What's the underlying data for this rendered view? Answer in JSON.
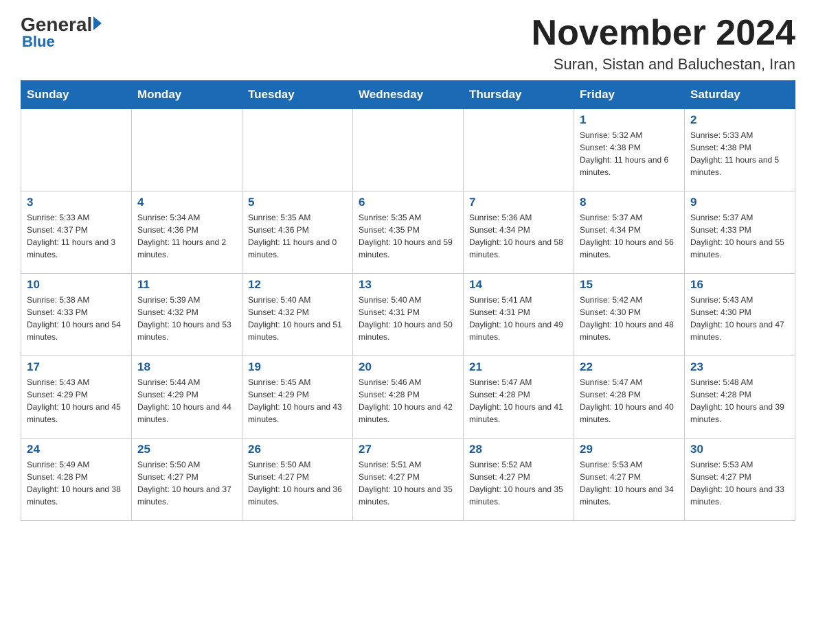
{
  "logo": {
    "general": "General",
    "blue": "Blue"
  },
  "title": "November 2024",
  "subtitle": "Suran, Sistan and Baluchestan, Iran",
  "weekdays": [
    "Sunday",
    "Monday",
    "Tuesday",
    "Wednesday",
    "Thursday",
    "Friday",
    "Saturday"
  ],
  "weeks": [
    [
      {
        "day": "",
        "info": ""
      },
      {
        "day": "",
        "info": ""
      },
      {
        "day": "",
        "info": ""
      },
      {
        "day": "",
        "info": ""
      },
      {
        "day": "",
        "info": ""
      },
      {
        "day": "1",
        "info": "Sunrise: 5:32 AM\nSunset: 4:38 PM\nDaylight: 11 hours and 6 minutes."
      },
      {
        "day": "2",
        "info": "Sunrise: 5:33 AM\nSunset: 4:38 PM\nDaylight: 11 hours and 5 minutes."
      }
    ],
    [
      {
        "day": "3",
        "info": "Sunrise: 5:33 AM\nSunset: 4:37 PM\nDaylight: 11 hours and 3 minutes."
      },
      {
        "day": "4",
        "info": "Sunrise: 5:34 AM\nSunset: 4:36 PM\nDaylight: 11 hours and 2 minutes."
      },
      {
        "day": "5",
        "info": "Sunrise: 5:35 AM\nSunset: 4:36 PM\nDaylight: 11 hours and 0 minutes."
      },
      {
        "day": "6",
        "info": "Sunrise: 5:35 AM\nSunset: 4:35 PM\nDaylight: 10 hours and 59 minutes."
      },
      {
        "day": "7",
        "info": "Sunrise: 5:36 AM\nSunset: 4:34 PM\nDaylight: 10 hours and 58 minutes."
      },
      {
        "day": "8",
        "info": "Sunrise: 5:37 AM\nSunset: 4:34 PM\nDaylight: 10 hours and 56 minutes."
      },
      {
        "day": "9",
        "info": "Sunrise: 5:37 AM\nSunset: 4:33 PM\nDaylight: 10 hours and 55 minutes."
      }
    ],
    [
      {
        "day": "10",
        "info": "Sunrise: 5:38 AM\nSunset: 4:33 PM\nDaylight: 10 hours and 54 minutes."
      },
      {
        "day": "11",
        "info": "Sunrise: 5:39 AM\nSunset: 4:32 PM\nDaylight: 10 hours and 53 minutes."
      },
      {
        "day": "12",
        "info": "Sunrise: 5:40 AM\nSunset: 4:32 PM\nDaylight: 10 hours and 51 minutes."
      },
      {
        "day": "13",
        "info": "Sunrise: 5:40 AM\nSunset: 4:31 PM\nDaylight: 10 hours and 50 minutes."
      },
      {
        "day": "14",
        "info": "Sunrise: 5:41 AM\nSunset: 4:31 PM\nDaylight: 10 hours and 49 minutes."
      },
      {
        "day": "15",
        "info": "Sunrise: 5:42 AM\nSunset: 4:30 PM\nDaylight: 10 hours and 48 minutes."
      },
      {
        "day": "16",
        "info": "Sunrise: 5:43 AM\nSunset: 4:30 PM\nDaylight: 10 hours and 47 minutes."
      }
    ],
    [
      {
        "day": "17",
        "info": "Sunrise: 5:43 AM\nSunset: 4:29 PM\nDaylight: 10 hours and 45 minutes."
      },
      {
        "day": "18",
        "info": "Sunrise: 5:44 AM\nSunset: 4:29 PM\nDaylight: 10 hours and 44 minutes."
      },
      {
        "day": "19",
        "info": "Sunrise: 5:45 AM\nSunset: 4:29 PM\nDaylight: 10 hours and 43 minutes."
      },
      {
        "day": "20",
        "info": "Sunrise: 5:46 AM\nSunset: 4:28 PM\nDaylight: 10 hours and 42 minutes."
      },
      {
        "day": "21",
        "info": "Sunrise: 5:47 AM\nSunset: 4:28 PM\nDaylight: 10 hours and 41 minutes."
      },
      {
        "day": "22",
        "info": "Sunrise: 5:47 AM\nSunset: 4:28 PM\nDaylight: 10 hours and 40 minutes."
      },
      {
        "day": "23",
        "info": "Sunrise: 5:48 AM\nSunset: 4:28 PM\nDaylight: 10 hours and 39 minutes."
      }
    ],
    [
      {
        "day": "24",
        "info": "Sunrise: 5:49 AM\nSunset: 4:28 PM\nDaylight: 10 hours and 38 minutes."
      },
      {
        "day": "25",
        "info": "Sunrise: 5:50 AM\nSunset: 4:27 PM\nDaylight: 10 hours and 37 minutes."
      },
      {
        "day": "26",
        "info": "Sunrise: 5:50 AM\nSunset: 4:27 PM\nDaylight: 10 hours and 36 minutes."
      },
      {
        "day": "27",
        "info": "Sunrise: 5:51 AM\nSunset: 4:27 PM\nDaylight: 10 hours and 35 minutes."
      },
      {
        "day": "28",
        "info": "Sunrise: 5:52 AM\nSunset: 4:27 PM\nDaylight: 10 hours and 35 minutes."
      },
      {
        "day": "29",
        "info": "Sunrise: 5:53 AM\nSunset: 4:27 PM\nDaylight: 10 hours and 34 minutes."
      },
      {
        "day": "30",
        "info": "Sunrise: 5:53 AM\nSunset: 4:27 PM\nDaylight: 10 hours and 33 minutes."
      }
    ]
  ]
}
